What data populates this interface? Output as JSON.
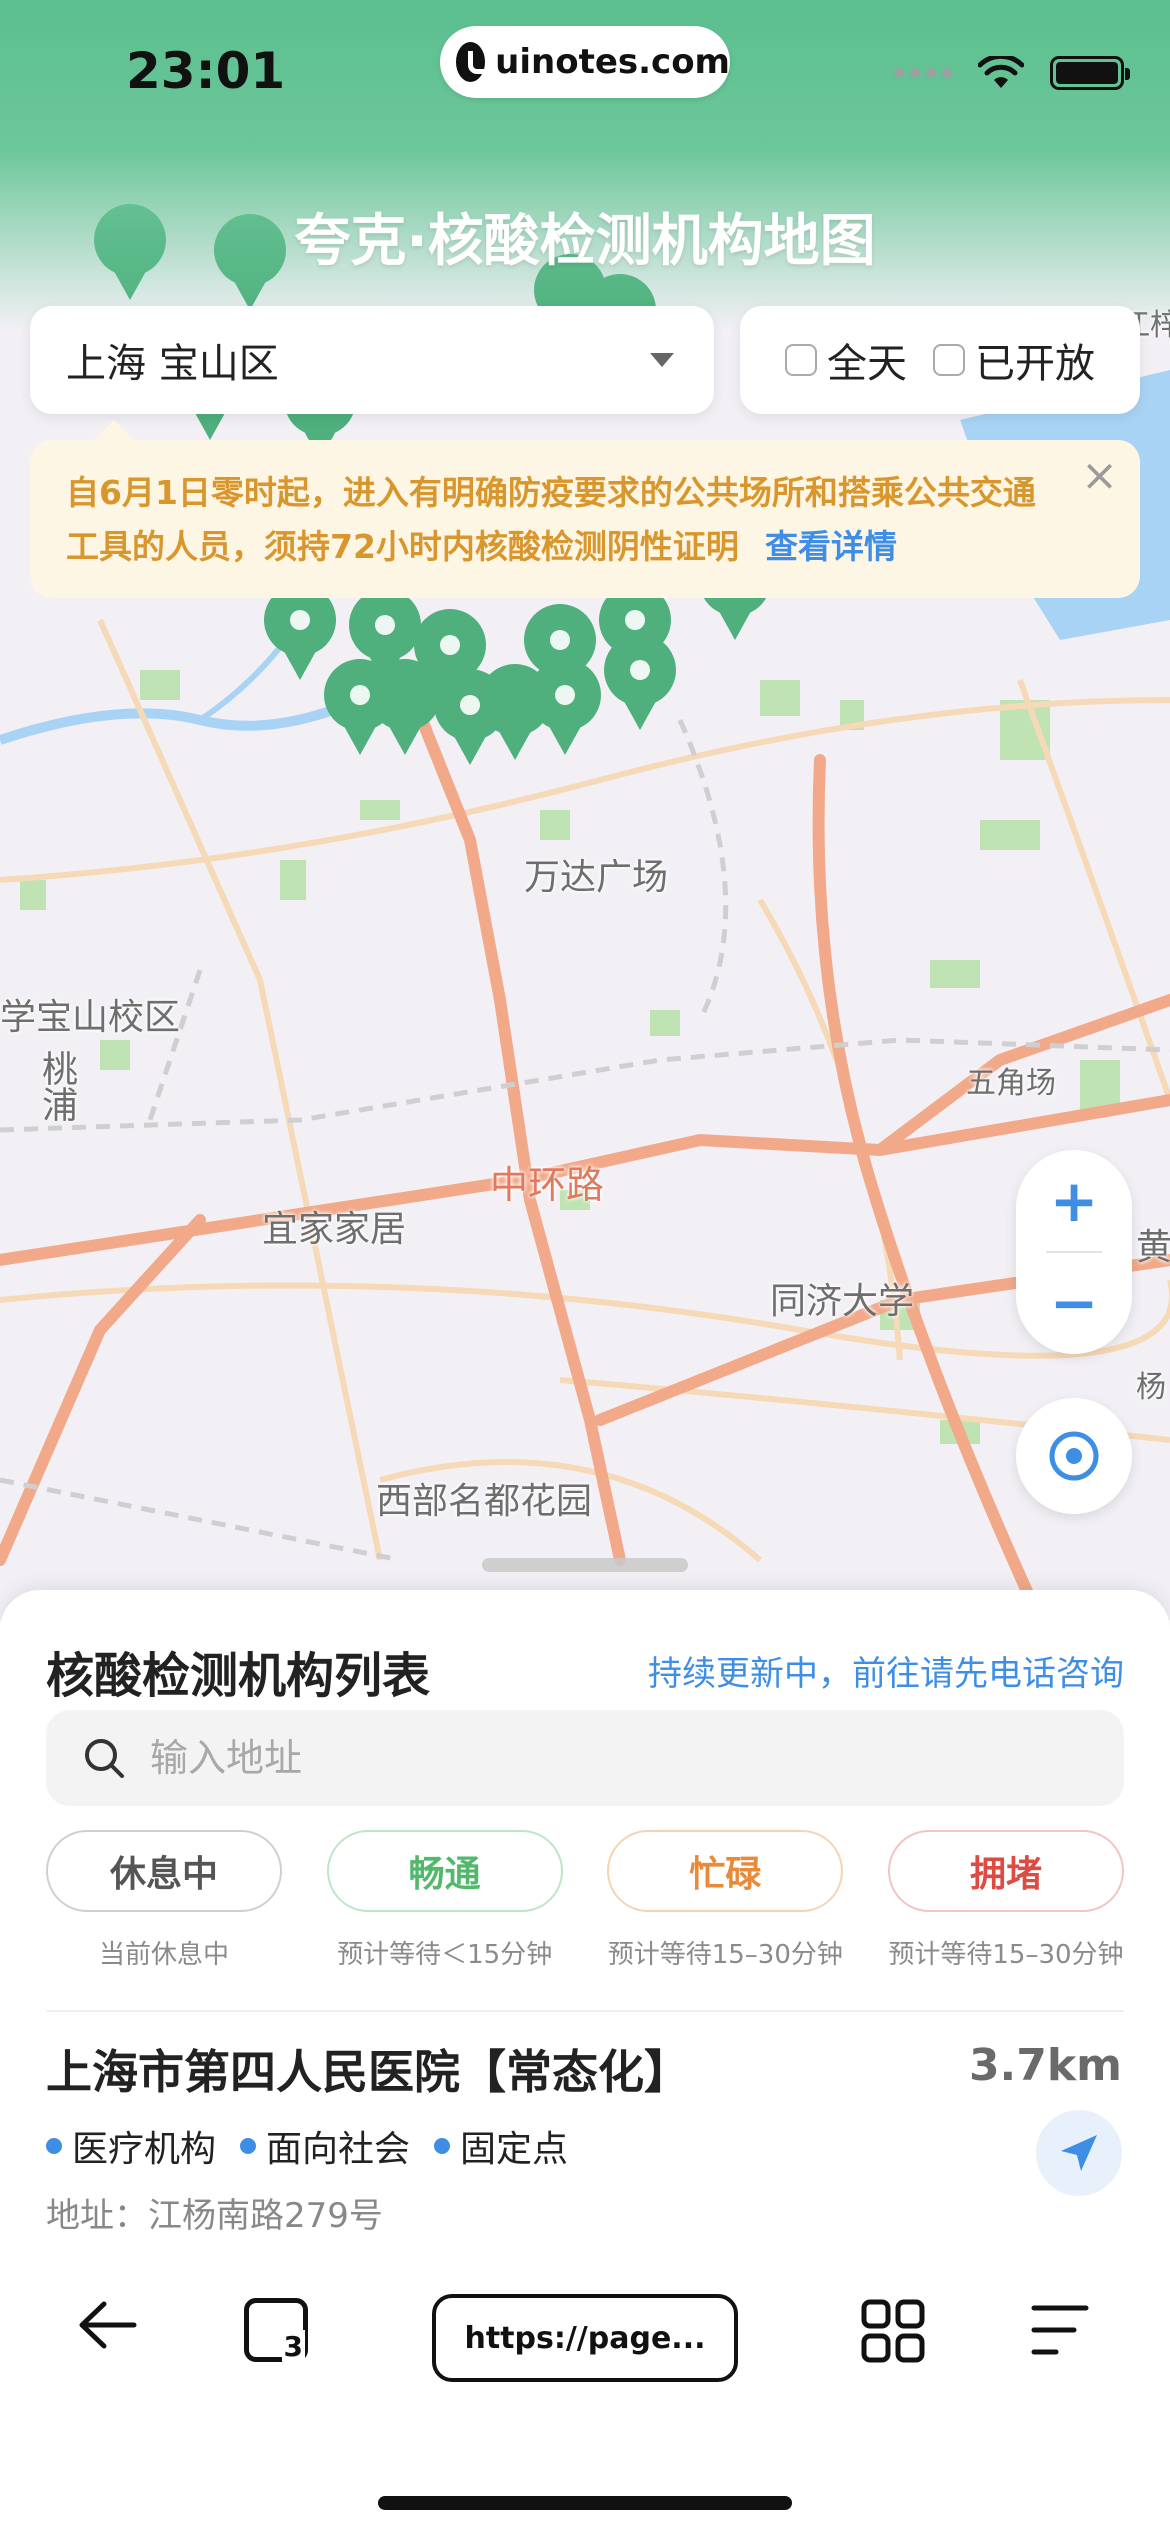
{
  "status_bar": {
    "time": "23:01",
    "site": "uinotes.com"
  },
  "header": {
    "title": "夸克·核酸检测机构地图"
  },
  "region": {
    "label": "上海 宝山区"
  },
  "filters": [
    {
      "label": "全天"
    },
    {
      "label": "已开放"
    }
  ],
  "notice": {
    "text": "自6月1日零时起，进入有明确防疫要求的公共场所和搭乘公共交通工具的人员，须持72小时内核酸检测阴性证明",
    "link": "查看详情"
  },
  "map": {
    "labels": {
      "wanda": "万达广场",
      "school": "学宝山校区",
      "taopu": "桃浦",
      "wujiaochang": "五角场",
      "zhonghuan": "中环路",
      "yijia": "宜家家居",
      "tongji": "同济大学",
      "xibu": "西部名都花园",
      "huang": "黄",
      "yang": "杨",
      "jiang": "江梓"
    }
  },
  "panel": {
    "title": "核酸检测机构列表",
    "notice_link": "持续更新中，前往请先电话咨询",
    "search_placeholder": "输入地址",
    "legend": [
      {
        "label": "休息中",
        "desc": "当前休息中",
        "color": "#555555"
      },
      {
        "label": "畅通",
        "desc": "预计等待＜15分钟",
        "color": "#52b86c"
      },
      {
        "label": "忙碌",
        "desc": "预计等待15–30分钟",
        "color": "#e98a3a"
      },
      {
        "label": "拥堵",
        "desc": "预计等待15–30分钟",
        "color": "#dd4b45"
      }
    ],
    "first_item": {
      "name": "上海市第四人民医院【常态化】",
      "distance": "3.7km",
      "tags": [
        "医疗机构",
        "面向社会",
        "固定点"
      ],
      "address": "地址：江杨南路279号"
    }
  },
  "browser": {
    "url": "https://page...",
    "tab_count": "3"
  }
}
